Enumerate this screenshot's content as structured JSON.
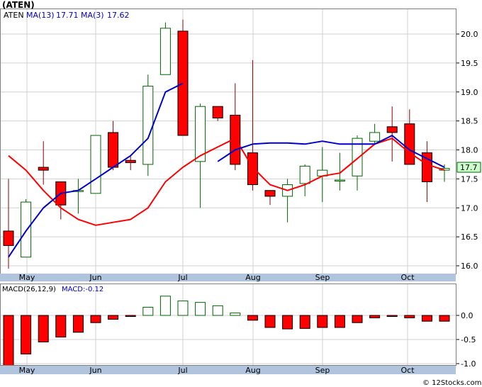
{
  "header": {
    "symbol": "(ATEN)",
    "legend_symbol": "ATEN",
    "ma13_label": "MA(13)",
    "ma13_value": "17.71",
    "ma3_label": "MA(3)",
    "ma3_value": "17.62",
    "last_price": "17.7"
  },
  "macd_header": {
    "label": "MACD(26,12,9)",
    "value_label": "MACD:-0.12"
  },
  "footer": {
    "credit": "© 12Stocks.com"
  },
  "colors": {
    "up": "#006400",
    "down": "#ff0000",
    "ma_short": "#ff0000",
    "ma_long": "#0000cc",
    "axis_bar": "#b0c4de",
    "grid": "#d0d0d0",
    "frame": "#808080"
  },
  "chart_data": [
    {
      "type": "candlestick",
      "title": "(ATEN)",
      "x_labels": [
        "May",
        "Jun",
        "Jul",
        "Aug",
        "Sep",
        "Oct"
      ],
      "ylim": [
        15.75,
        20.3
      ],
      "yticks": [
        16.0,
        16.5,
        17.0,
        17.5,
        18.0,
        18.5,
        19.0,
        19.5,
        20.0
      ],
      "grid": true,
      "candles": [
        {
          "open": 16.6,
          "close": 16.35,
          "high": 17.5,
          "low": 15.95
        },
        {
          "open": 16.15,
          "close": 17.1,
          "high": 17.15,
          "low": 16.15
        },
        {
          "open": 17.7,
          "close": 17.65,
          "high": 18.15,
          "low": 17.4
        },
        {
          "open": 17.45,
          "close": 17.05,
          "high": 17.45,
          "low": 16.8
        },
        {
          "open": 17.3,
          "close": 17.3,
          "high": 17.5,
          "low": 16.9
        },
        {
          "open": 17.25,
          "close": 18.25,
          "high": 18.25,
          "low": 17.25
        },
        {
          "open": 18.3,
          "close": 17.7,
          "high": 18.5,
          "low": 17.65
        },
        {
          "open": 17.82,
          "close": 17.78,
          "high": 17.9,
          "low": 17.65
        },
        {
          "open": 17.75,
          "close": 19.1,
          "high": 19.3,
          "low": 17.55
        },
        {
          "open": 19.3,
          "close": 20.1,
          "high": 20.2,
          "low": 19.3
        },
        {
          "open": 20.05,
          "close": 18.25,
          "high": 20.25,
          "low": 18.25
        },
        {
          "open": 17.8,
          "close": 18.75,
          "high": 18.8,
          "low": 17.0
        },
        {
          "open": 18.75,
          "close": 18.55,
          "high": 18.75,
          "low": 18.5
        },
        {
          "open": 18.6,
          "close": 17.75,
          "high": 19.15,
          "low": 17.65
        },
        {
          "open": 17.95,
          "close": 17.4,
          "high": 19.55,
          "low": 17.3
        },
        {
          "open": 17.3,
          "close": 17.2,
          "high": 17.3,
          "low": 17.05
        },
        {
          "open": 17.2,
          "close": 17.4,
          "high": 17.5,
          "low": 16.75
        },
        {
          "open": 17.42,
          "close": 17.72,
          "high": 17.75,
          "low": 17.2
        },
        {
          "open": 17.55,
          "close": 17.65,
          "high": 18.05,
          "low": 17.1
        },
        {
          "open": 17.48,
          "close": 17.48,
          "high": 17.95,
          "low": 17.3
        },
        {
          "open": 17.55,
          "close": 18.2,
          "high": 18.25,
          "low": 17.3
        },
        {
          "open": 18.15,
          "close": 18.3,
          "high": 18.45,
          "low": 18.1
        },
        {
          "open": 18.4,
          "close": 18.3,
          "high": 18.75,
          "low": 17.8
        },
        {
          "open": 18.45,
          "close": 17.75,
          "high": 18.7,
          "low": 17.75
        },
        {
          "open": 17.95,
          "close": 17.45,
          "high": 18.15,
          "low": 17.1
        },
        {
          "open": 17.65,
          "close": 17.68,
          "high": 17.75,
          "low": 17.45
        }
      ],
      "series": [
        {
          "name": "MA(13)",
          "values": [
            16.15,
            16.6,
            17.0,
            17.25,
            17.3,
            17.5,
            17.7,
            17.9,
            18.2,
            19.0,
            19.15,
            null,
            17.8,
            18.0,
            18.1,
            18.12,
            18.12,
            18.1,
            18.15,
            18.1,
            18.1,
            18.1,
            18.25,
            18.0,
            17.85,
            17.7
          ]
        },
        {
          "name": "MA(3)",
          "values": [
            17.9,
            17.65,
            17.3,
            17.0,
            16.8,
            16.7,
            16.75,
            16.8,
            17.0,
            17.45,
            17.7,
            17.9,
            18.05,
            18.2,
            17.7,
            17.4,
            17.3,
            17.4,
            17.55,
            17.6,
            17.85,
            18.1,
            18.2,
            17.95,
            17.75,
            17.65
          ]
        }
      ]
    },
    {
      "type": "bar",
      "title": "MACD(26,12,9)",
      "x_labels": [
        "May",
        "Jun",
        "Jul",
        "Aug",
        "Sep",
        "Oct"
      ],
      "ylim": [
        -1.05,
        0.4
      ],
      "yticks": [
        -1.0,
        -0.5,
        0.0
      ],
      "ytick_labels": [
        "-1.0",
        "-0.5",
        "0.0"
      ],
      "values": [
        -1.05,
        -0.8,
        -0.55,
        -0.45,
        -0.35,
        -0.15,
        -0.08,
        -0.02,
        0.17,
        0.4,
        0.3,
        0.27,
        0.2,
        0.05,
        -0.1,
        -0.25,
        -0.28,
        -0.27,
        -0.25,
        -0.25,
        -0.15,
        -0.05,
        -0.01,
        -0.05,
        -0.12,
        -0.12
      ]
    }
  ]
}
